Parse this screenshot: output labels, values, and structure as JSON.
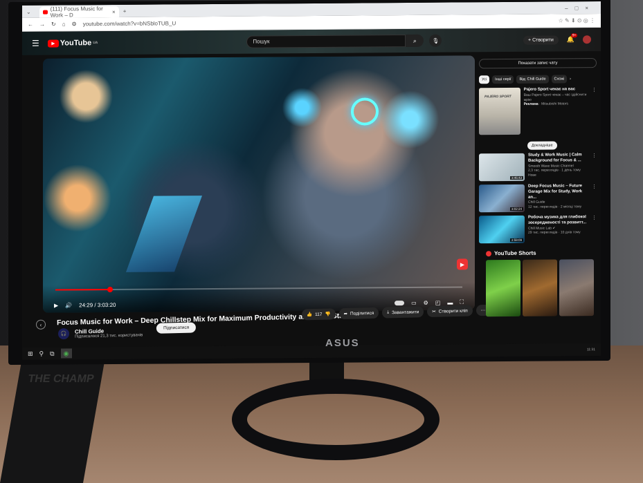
{
  "browser": {
    "tab_title": "(111) Focus Music for Work – D",
    "url": "youtube.com/watch?v=bNSbloTUB_U"
  },
  "header": {
    "logo": "YouTube",
    "region": "UA",
    "search_placeholder": "Пошук",
    "create_label": "Створити",
    "notifications": "9+"
  },
  "player": {
    "time": "24:29 / 3:03:20",
    "progress_fraction": 0.134
  },
  "video": {
    "title": "Focus Music for Work – Deep Chillstep Mix for Maximum Productivity and Flow State",
    "channel": "Chill Guide",
    "subscribers": "Підписалося 21,3 тис. користувачів",
    "subscribe_label": "Підписатися",
    "likes": "117",
    "share_label": "Поділитися",
    "download_label": "Завантажити",
    "clip_label": "Створити кліп"
  },
  "sidebar": {
    "chat_button": "Показати запис чату",
    "chips": [
      "Усі",
      "Інші серії",
      "Від: Chill Guide",
      "Схожі"
    ],
    "ad": {
      "title": "Pajero Sport чекає на вас",
      "desc": "Ваш Pajero Sport чекає – час здійснити мрію",
      "sponsor_label": "Реклама",
      "sponsor": "Mitsubishi Motors",
      "thumb_text": "PAJERO SPORT",
      "cta": "Докладніше"
    },
    "videos": [
      {
        "title": "Study & Work Music | Calm Background for Focus & ...",
        "channel": "Smooth Wave Music Channel",
        "meta": "2,3 тис. переглядів · 1 день тому",
        "badge": "Нове",
        "duration": "3:46:43"
      },
      {
        "title": "Deep Focus Music – Future Garage Mix for Study, Work an...",
        "channel": "Chill Guide",
        "meta": "12 тис. переглядів · 2 місяці тому",
        "duration": "3:02:24"
      },
      {
        "title": "Робоча музика для глибокої зосередженості та розвитт...",
        "channel": "Chill Music Lab ✔",
        "meta": "29 тис. переглядів · 10 днів тому",
        "duration": "2:59:09"
      }
    ],
    "shorts_title": "YouTube Shorts"
  },
  "taskbar": {
    "clock": "11:31"
  },
  "monitor": {
    "brand": "ASUS"
  },
  "background": {
    "box_text": "THE CHAMP"
  }
}
